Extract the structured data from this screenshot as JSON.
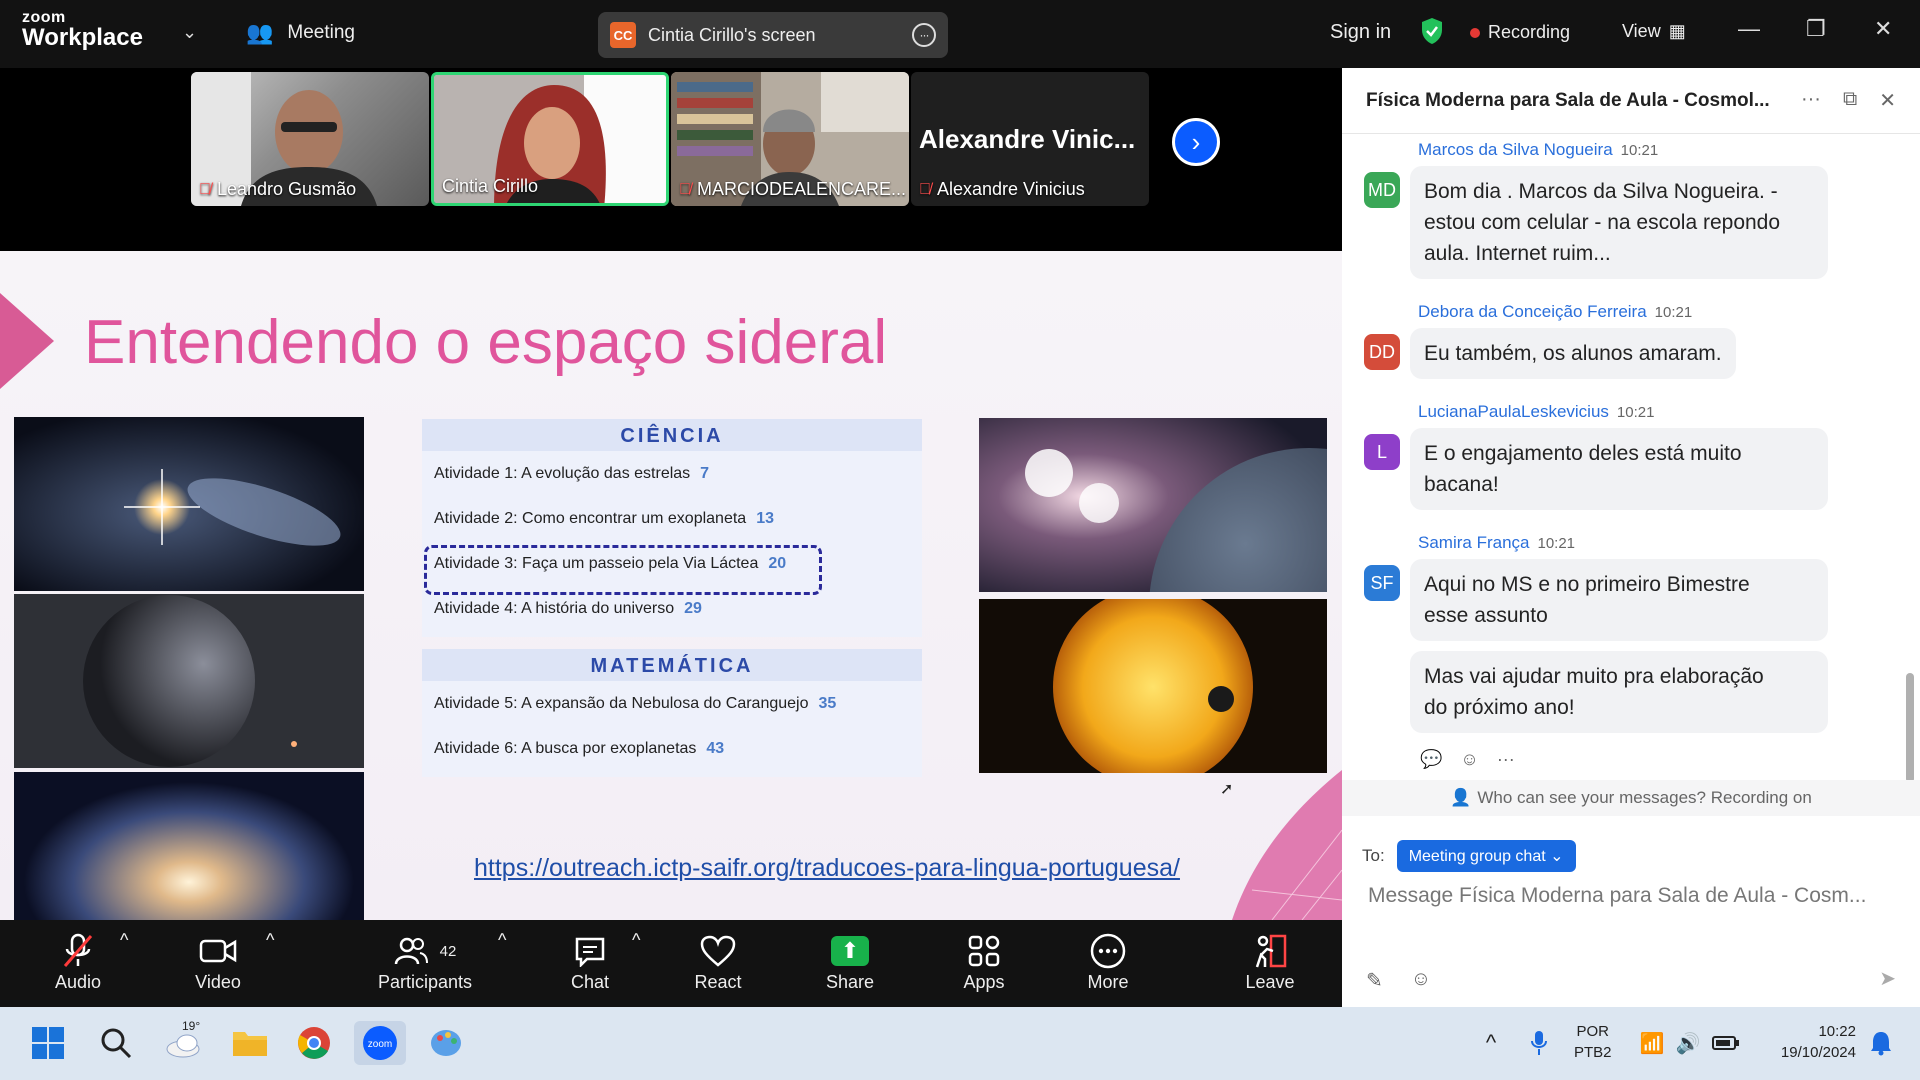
{
  "topbar": {
    "logo_line1": "zoom",
    "logo_line2": "Workplace",
    "meeting_label": "Meeting",
    "screen_initials": "CC",
    "screen_label": "Cintia Cirillo's screen",
    "sign_in": "Sign in",
    "recording": "Recording",
    "view": "View"
  },
  "participants": [
    {
      "name": "Leandro Gusmão",
      "muted": true
    },
    {
      "name": "Cintia Cirillo",
      "muted": false
    },
    {
      "name": "MARCIODEALENCARE...",
      "muted": true
    },
    {
      "name": "Alexandre Vinicius",
      "muted": true,
      "display_name": "Alexandre  Vinic..."
    }
  ],
  "slide": {
    "title": "Entendendo o espaço sideral",
    "sections": [
      {
        "heading": "CIÊNCIA",
        "items": [
          {
            "text": "Atividade 1: A evolução das estrelas",
            "page": "7"
          },
          {
            "text": "Atividade 2: Como encontrar um exoplaneta",
            "page": "13"
          },
          {
            "text": "Atividade 3: Faça um passeio pela Via Láctea",
            "page": "20"
          },
          {
            "text": "Atividade 4: A história do universo",
            "page": "29"
          }
        ]
      },
      {
        "heading": "MATEMÁTICA",
        "items": [
          {
            "text": "Atividade 5: A expansão da Nebulosa do Caranguejo",
            "page": "35"
          },
          {
            "text": "Atividade 6: A busca por exoplanetas",
            "page": "43"
          }
        ]
      }
    ],
    "link": "https://outreach.ictp-saifr.org/traducoes-para-lingua-portuguesa/"
  },
  "chat": {
    "title": "Física Moderna para Sala de Aula - Cosmol...",
    "messages": [
      {
        "initials": "MD",
        "color": "#3aa757",
        "sender": "Marcos da Silva Nogueira",
        "time": "10:21",
        "lines": [
          "Bom dia . Marcos da Silva Nogueira. -",
          "estou com celular - na escola repondo",
          "aula.  Internet ruim..."
        ]
      },
      {
        "initials": "DD",
        "color": "#d44c3a",
        "sender": "Debora da Conceição Ferreira",
        "time": "10:21",
        "lines": [
          "Eu também, os alunos amaram."
        ]
      },
      {
        "initials": "L",
        "color": "#8e3fc9",
        "sender": "LucianaPaulaLeskevicius",
        "time": "10:21",
        "lines": [
          "E o engajamento deles está muito",
          "bacana!"
        ]
      },
      {
        "initials": "SF",
        "color": "#2b7bd6",
        "sender": "Samira França",
        "time": "10:21",
        "lines": [
          "Aqui no MS e no primeiro Bimestre",
          "esse assunto"
        ]
      },
      {
        "lines": [
          "Mas vai ajudar muito pra elaboração",
          "do próximo ano!"
        ]
      }
    ],
    "privacy_note": "Who can see your messages? Recording on",
    "to_label": "To:",
    "to_value": "Meeting group chat",
    "input_placeholder": "Message Física Moderna para Sala de Aula - Cosm..."
  },
  "toolbar": {
    "audio": "Audio",
    "video": "Video",
    "participants": "Participants",
    "participants_count": "42",
    "chat": "Chat",
    "react": "React",
    "share": "Share",
    "apps": "Apps",
    "more": "More",
    "leave": "Leave"
  },
  "taskbar": {
    "weather": "19°",
    "lang1": "POR",
    "lang2": "PTB2",
    "time": "10:22",
    "date": "19/10/2024"
  }
}
